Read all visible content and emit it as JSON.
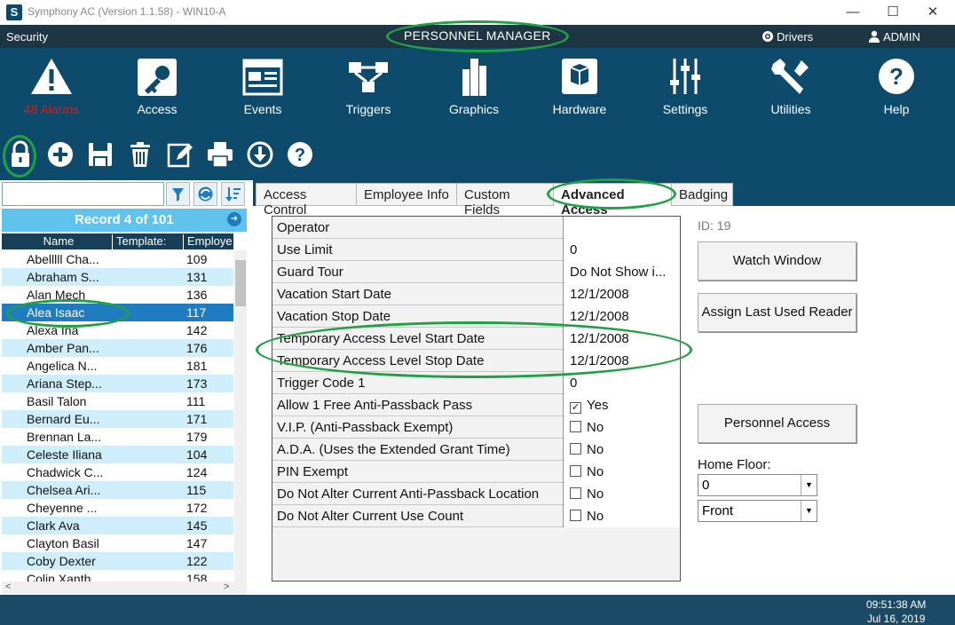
{
  "window": {
    "logo": "S",
    "title": "Symphony AC  (Version 1.1.58) - WIN10-A",
    "minimize": "—",
    "maximize": "☐",
    "close": "✕"
  },
  "secbar": {
    "security": "Security",
    "page_title": "PERSONNEL MANAGER",
    "drivers": "Drivers",
    "admin": "ADMIN"
  },
  "toolbar": {
    "alarms": "48 Alarms",
    "access": "Access",
    "events": "Events",
    "triggers": "Triggers",
    "graphics": "Graphics",
    "hardware": "Hardware",
    "settings": "Settings",
    "utilities": "Utilities",
    "help": "Help"
  },
  "list": {
    "search_value": "",
    "record": "Record 4 of 101",
    "columns": [
      "Name",
      "Template:",
      "Employe"
    ],
    "rows": [
      {
        "name": "Abelllll Cha...",
        "id": "109"
      },
      {
        "name": "Abraham S...",
        "id": "131"
      },
      {
        "name": "Alan Mech",
        "id": "136"
      },
      {
        "name": "Alea Isaac",
        "id": "117"
      },
      {
        "name": "Alexa Ina",
        "id": "142"
      },
      {
        "name": "Amber Pan...",
        "id": "176"
      },
      {
        "name": "Angelica N...",
        "id": "181"
      },
      {
        "name": "Ariana Step...",
        "id": "173"
      },
      {
        "name": "Basil Talon",
        "id": "111"
      },
      {
        "name": "Bernard Eu...",
        "id": "171"
      },
      {
        "name": "Brennan La...",
        "id": "179"
      },
      {
        "name": "Celeste Iliana",
        "id": "104"
      },
      {
        "name": "Chadwick C...",
        "id": "124"
      },
      {
        "name": "Chelsea Ari...",
        "id": "115"
      },
      {
        "name": "Cheyenne ...",
        "id": "172"
      },
      {
        "name": "Clark Ava",
        "id": "145"
      },
      {
        "name": "Clayton Basil",
        "id": "147"
      },
      {
        "name": "Coby Dexter",
        "id": "122"
      },
      {
        "name": "Colin Xanth",
        "id": "158"
      }
    ],
    "scroll_left": "<",
    "scroll_right": ">"
  },
  "tabs": [
    "Access Control",
    "Employee Info",
    "Custom Fields",
    "Advanced Access",
    "Badging"
  ],
  "grid": [
    {
      "label": "Operator",
      "value": ""
    },
    {
      "label": "Use Limit",
      "value": "0"
    },
    {
      "label": "Guard Tour",
      "value": "Do Not Show i..."
    },
    {
      "label": "Vacation Start Date",
      "value": "12/1/2008"
    },
    {
      "label": "Vacation Stop Date",
      "value": "12/1/2008"
    },
    {
      "label": "Temporary Access Level Start Date",
      "value": "12/1/2008"
    },
    {
      "label": "Temporary Access Level Stop Date",
      "value": "12/1/2008"
    },
    {
      "label": "Trigger Code 1",
      "value": "0"
    },
    {
      "label": "Allow 1 Free Anti-Passback Pass",
      "value": "Yes",
      "checkbox": true,
      "checked": true
    },
    {
      "label": "V.I.P. (Anti-Passback Exempt)",
      "value": "No",
      "checkbox": true,
      "checked": false
    },
    {
      "label": "A.D.A. (Uses the Extended Grant Time)",
      "value": "No",
      "checkbox": true,
      "checked": false
    },
    {
      "label": "PIN Exempt",
      "value": "No",
      "checkbox": true,
      "checked": false
    },
    {
      "label": "Do Not Alter Current Anti-Passback Location",
      "value": "No",
      "checkbox": true,
      "checked": false
    },
    {
      "label": "Do Not Alter Current Use Count",
      "value": "No",
      "checkbox": true,
      "checked": false
    }
  ],
  "side": {
    "id_label": "ID:  19",
    "watch_window": "Watch Window",
    "assign_reader": "Assign Last Used Reader",
    "personnel_access": "Personnel Access",
    "home_floor_label": "Home Floor:",
    "floor_value": "0",
    "side_value": "Front"
  },
  "status": {
    "time": "09:51:38 AM",
    "date": "Jul 16, 2019"
  },
  "colors": {
    "toolbar_bg": "#0d4a6c",
    "header_bg": "#1e3544",
    "record_bar": "#5fc3ee",
    "selected_row": "#1f7cc0",
    "highlight_oval": "#22a045",
    "alarm_text": "#d02020"
  }
}
